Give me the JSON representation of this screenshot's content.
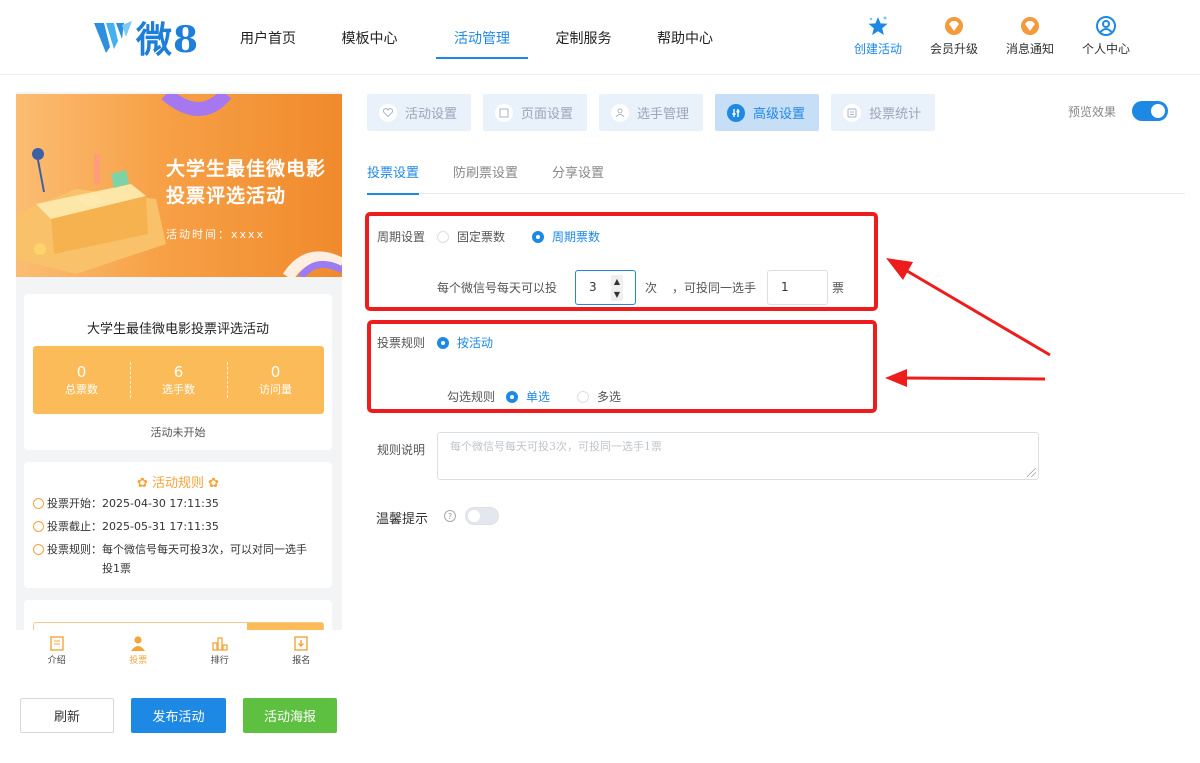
{
  "brand": {
    "logo_text": "微8"
  },
  "nav": {
    "items": [
      {
        "label": "用户首页"
      },
      {
        "label": "模板中心"
      },
      {
        "label": "活动管理"
      },
      {
        "label": "定制服务"
      },
      {
        "label": "帮助中心"
      }
    ],
    "active": "活动管理",
    "right": [
      {
        "label": "创建活动",
        "icon": "star-icon"
      },
      {
        "label": "会员升级",
        "icon": "diamond-icon"
      },
      {
        "label": "消息通知",
        "icon": "bell-icon"
      },
      {
        "label": "个人中心",
        "icon": "user-icon"
      }
    ]
  },
  "preview": {
    "banner_title_line1": "大学生最佳微电影",
    "banner_title_line2": "投票评选活动",
    "banner_time": "活动时间：xxxx",
    "card_title": "大学生最佳微电影投票评选活动",
    "stats": [
      {
        "value": "0",
        "label": "总票数"
      },
      {
        "value": "6",
        "label": "选手数"
      },
      {
        "value": "0",
        "label": "访问量"
      }
    ],
    "status": "活动未开始",
    "rules_title": "活动规则",
    "rules": [
      {
        "label": "投票开始：",
        "value": "2025-04-30 17:11:35"
      },
      {
        "label": "投票截止：",
        "value": "2025-05-31 17:11:35"
      },
      {
        "label": "投票规则：",
        "value": "每个微信号每天可投3次，可以对同一选手投1票"
      }
    ],
    "tabs": [
      {
        "label": "介绍",
        "icon": "intro-icon"
      },
      {
        "label": "投票",
        "icon": "vote-icon"
      },
      {
        "label": "排行",
        "icon": "rank-icon"
      },
      {
        "label": "报名",
        "icon": "signup-icon"
      }
    ],
    "active_tab": "投票"
  },
  "buttons": {
    "refresh": "刷新",
    "publish": "发布活动",
    "poster": "活动海报"
  },
  "steps": [
    {
      "label": "活动设置"
    },
    {
      "label": "页面设置"
    },
    {
      "label": "选手管理"
    },
    {
      "label": "高级设置"
    },
    {
      "label": "投票统计"
    }
  ],
  "active_step": "高级设置",
  "preview_effect": {
    "label": "预览效果",
    "enabled": true
  },
  "subtabs": [
    {
      "label": "投票设置"
    },
    {
      "label": "防刷票设置"
    },
    {
      "label": "分享设置"
    }
  ],
  "active_subtab": "投票设置",
  "form": {
    "period_label": "周期设置",
    "period_options": [
      "固定票数",
      "周期票数"
    ],
    "period_selected": "周期票数",
    "per_day_prefix": "每个微信号每天可以投",
    "per_day_value": "3",
    "per_day_unit": "次",
    "same_player_prefix": "，可投同一选手",
    "same_player_value": "1",
    "same_player_unit": "票",
    "vote_rule_label": "投票规则",
    "vote_rule_option": "按活动",
    "check_rule_label": "勾选规则",
    "check_options": [
      "单选",
      "多选"
    ],
    "check_selected": "单选",
    "desc_label": "规则说明",
    "desc_placeholder": "每个微信号每天可投3次，可投同一选手1票",
    "tip_label": "温馨提示",
    "tip_enabled": false
  },
  "colors": {
    "primary": "#1e88e5",
    "orange": "#f5a43a",
    "green": "#5ec040",
    "highlight": "#ee1d1d"
  }
}
